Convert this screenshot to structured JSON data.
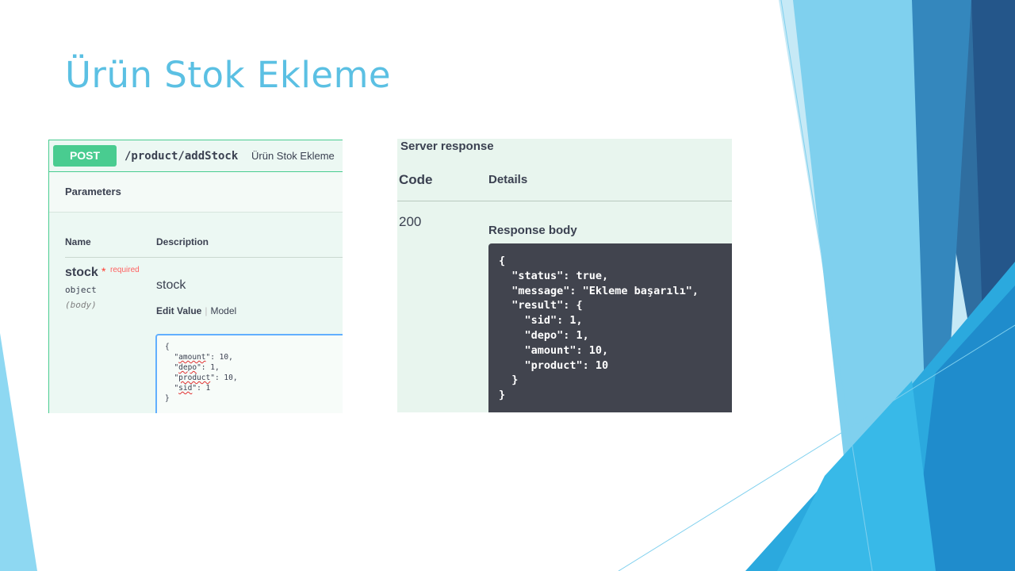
{
  "slide": {
    "title": "Ürün Stok Ekleme"
  },
  "request": {
    "method": "POST",
    "path": "/product/addStock",
    "summary": "Ürün Stok Ekleme",
    "parameters_title": "Parameters",
    "columns": {
      "name": "Name",
      "description": "Description"
    },
    "param": {
      "name": "stock",
      "required_star": "*",
      "required_label": "required",
      "type": "object",
      "in": "(body)",
      "description": "stock"
    },
    "tabs": {
      "edit": "Edit Value",
      "separator": "|",
      "model": "Model"
    },
    "body_lines": [
      {
        "pre": "{",
        "key": "",
        "post": ""
      },
      {
        "pre": "  \"",
        "key": "amount",
        "post": "\": 10,"
      },
      {
        "pre": "  \"",
        "key": "depo",
        "post": "\": 1,"
      },
      {
        "pre": "  \"",
        "key": "product",
        "post": "\": 10,"
      },
      {
        "pre": "  \"",
        "key": "sid",
        "post": "\": 1"
      },
      {
        "pre": "}",
        "key": "",
        "post": ""
      }
    ]
  },
  "response": {
    "title": "Server response",
    "col_code": "Code",
    "col_details": "Details",
    "code": "200",
    "body_label": "Response body",
    "body": "{\n  \"status\": true,\n  \"message\": \"Ekleme başarılı\",\n  \"result\": {\n    \"sid\": 1,\n    \"depo\": 1,\n    \"amount\": 10,\n    \"product\": 10\n  }\n}"
  },
  "colors": {
    "title": "#5bc0e3",
    "post_green": "#49cc90",
    "editor_border": "#61affe",
    "code_bg": "#41444e"
  }
}
